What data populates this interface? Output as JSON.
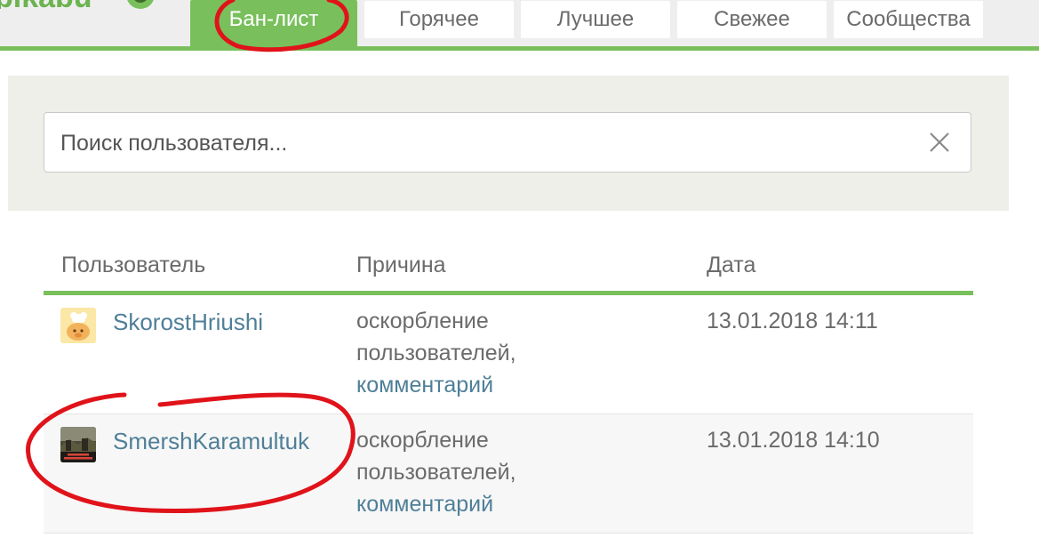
{
  "colors": {
    "accent_green": "#79c05c",
    "link_blue": "#4f7f98",
    "text_gray": "#6b6b6b",
    "annotation_red": "#e0131a"
  },
  "tabs": [
    {
      "label": "Бан-лист",
      "active": true
    },
    {
      "label": "Горячее",
      "active": false
    },
    {
      "label": "Лучшее",
      "active": false
    },
    {
      "label": "Свежее",
      "active": false
    },
    {
      "label": "Сообщества",
      "active": false
    }
  ],
  "search": {
    "placeholder": "Поиск пользователя...",
    "value": "",
    "clear_icon": "close-icon"
  },
  "table": {
    "columns": [
      "Пользователь",
      "Причина",
      "Дата"
    ],
    "rows": [
      {
        "username": "SkorostHriushi",
        "avatar_icon": "cartoon-avatar",
        "reason_line1": "оскорбление",
        "reason_line2": "пользователей,",
        "reason_link": "комментарий",
        "date": "13.01.2018 14:11"
      },
      {
        "username": "SmershKaramultuk",
        "avatar_icon": "photo-avatar",
        "reason_line1": "оскорбление",
        "reason_line2": "пользователей,",
        "reason_link": "комментарий",
        "date": "13.01.2018 14:10"
      }
    ]
  }
}
